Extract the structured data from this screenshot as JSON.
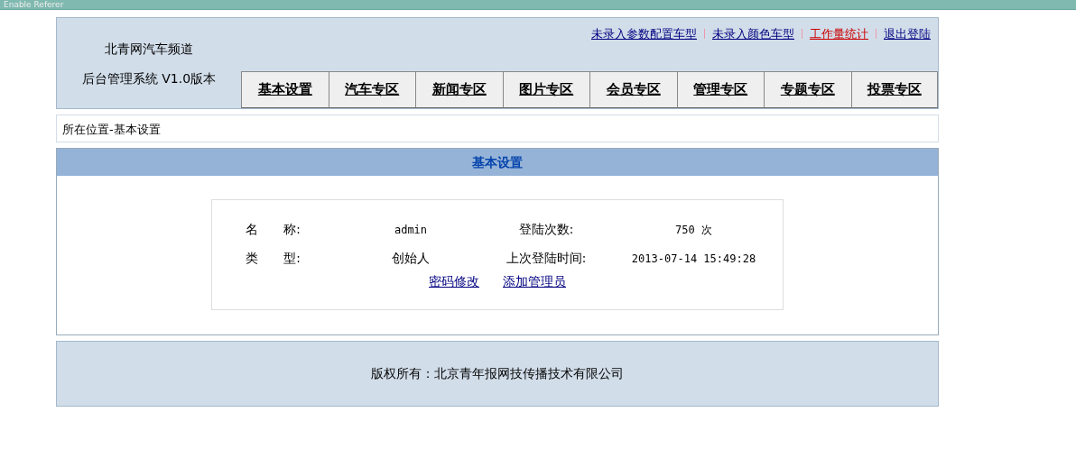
{
  "browser_bar": {
    "text": "Enable Referer"
  },
  "header": {
    "site_name": "北青网汽车频道",
    "system_name": "后台管理系统 V1.0版本",
    "top_links": [
      {
        "label": "未录入参数配置车型",
        "color": "#000080"
      },
      {
        "label": "未录入颜色车型",
        "color": "#000080"
      },
      {
        "label": "工作量统计",
        "color": "#cc0000"
      },
      {
        "label": "退出登陆",
        "color": "#000080"
      }
    ],
    "tabs": [
      "基本设置",
      "汽车专区",
      "新闻专区",
      "图片专区",
      "会员专区",
      "管理专区",
      "专题专区",
      "投票专区"
    ]
  },
  "breadcrumb": "所在位置-基本设置",
  "panel": {
    "title": "基本设置",
    "rows": [
      {
        "label": "名　　称:",
        "value": "admin",
        "label2": "登陆次数:",
        "value2": "750 次"
      },
      {
        "label": "类　　型:",
        "value": "创始人",
        "label2": "上次登陆时间:",
        "value2": "2013-07-14 15:49:28"
      }
    ],
    "links": [
      "密码修改",
      "添加管理员"
    ]
  },
  "footer": "版权所有：北京青年报网技传播技术有限公司"
}
